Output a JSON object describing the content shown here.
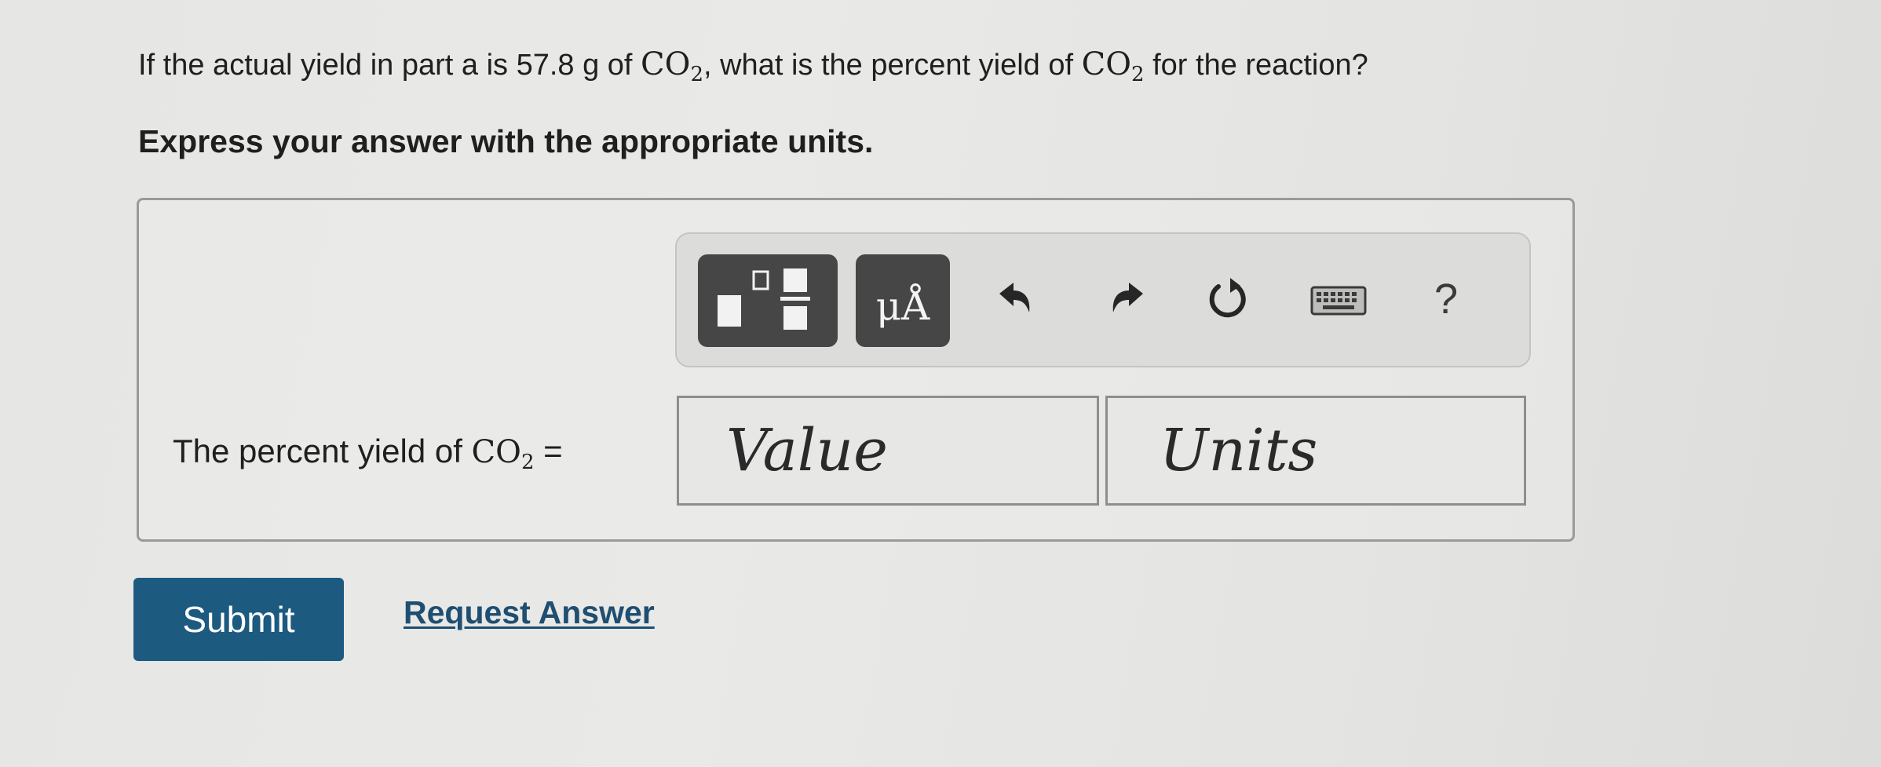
{
  "question": {
    "prefix": "If the actual yield in part a is 57.8 g of ",
    "formula_1": "CO",
    "sub_1": "2",
    "middle": ", what is the percent yield of ",
    "formula_2": "CO",
    "sub_2": "2",
    "suffix": " for the reaction?"
  },
  "instruction": "Express your answer with the appropriate units.",
  "toolbar": {
    "units_label": "μÅ",
    "help_label": "?",
    "icons": [
      "template-fraction-icon",
      "units-icon",
      "undo-icon",
      "redo-icon",
      "reset-icon",
      "keyboard-icon",
      "help-icon"
    ]
  },
  "answer": {
    "label_prefix": "The percent yield of ",
    "label_formula": "CO",
    "label_sub": "2",
    "label_suffix": " =",
    "value_placeholder": "Value",
    "units_placeholder": "Units"
  },
  "actions": {
    "submit_label": "Submit",
    "request_answer_label": "Request Answer"
  },
  "colors": {
    "submit_bg": "#1c5a80",
    "toolbar_button_bg": "#464646",
    "link": "#1e4e71"
  }
}
